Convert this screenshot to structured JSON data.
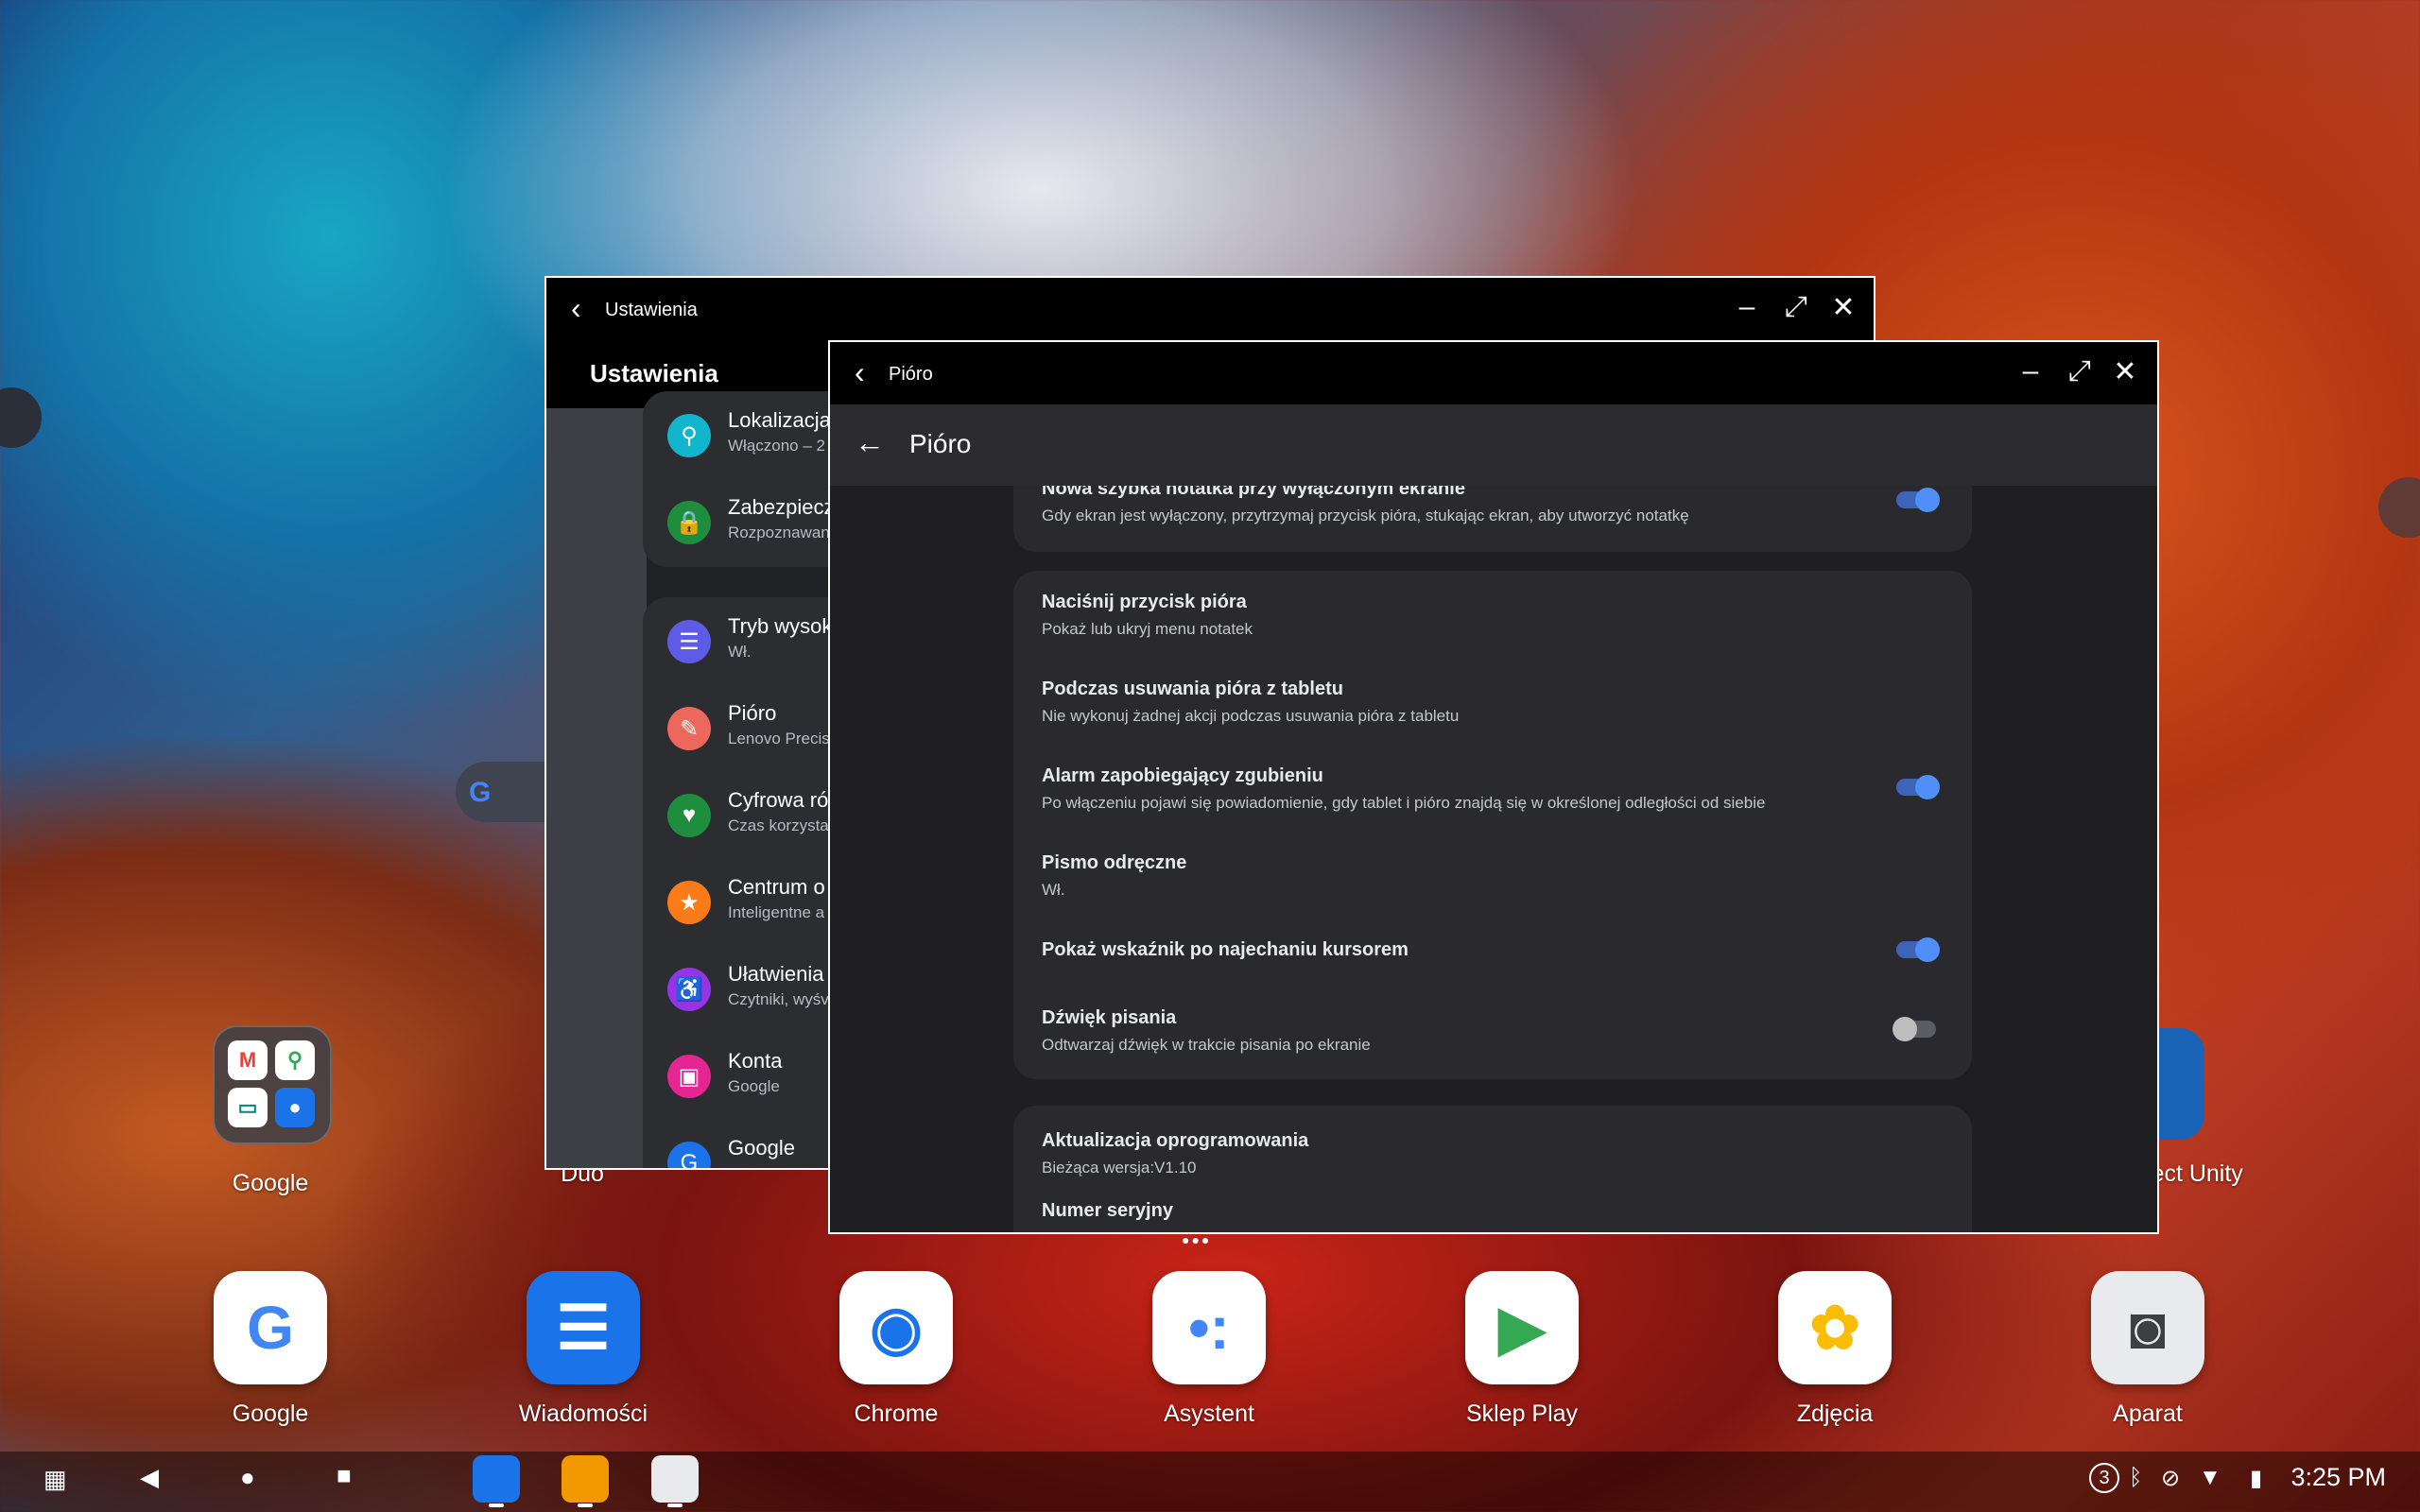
{
  "desktop": {
    "folder_label": "Google",
    "duo_label": "Duo",
    "unity_label": "ject Unity",
    "search_logo": "G"
  },
  "dock": [
    {
      "label": "Google",
      "icon": "google-icon",
      "glyph": "G",
      "color": "#4285f4"
    },
    {
      "label": "Wiadomości",
      "icon": "messages-icon",
      "glyph": "☰",
      "color": "#1a73e8"
    },
    {
      "label": "Chrome",
      "icon": "chrome-icon",
      "glyph": "◉",
      "color": "#1a73e8"
    },
    {
      "label": "Asystent",
      "icon": "assistant-icon",
      "glyph": "•:",
      "color": "#4285f4"
    },
    {
      "label": "Sklep Play",
      "icon": "play-store-icon",
      "glyph": "▶",
      "color": "#34a853"
    },
    {
      "label": "Zdjęcia",
      "icon": "photos-icon",
      "glyph": "✿",
      "color": "#fbbc04"
    },
    {
      "label": "Aparat",
      "icon": "camera-icon",
      "glyph": "◙",
      "color": "#5f6368"
    }
  ],
  "taskbar": {
    "time": "3:25 PM",
    "notification_count": "3"
  },
  "settings_window": {
    "title": "Ustawienia",
    "header": "Ustawienia",
    "items": [
      {
        "title": "Lokalizacja",
        "sub": "Włączono – 2",
        "color": "#12b5cb",
        "icon": "location-icon",
        "glyph": "⚲"
      },
      {
        "title": "Zabezpiecz",
        "sub": "Rozpoznawan",
        "color": "#1e8e3e",
        "icon": "lock-icon",
        "glyph": "🔒"
      },
      {
        "title": "Tryb wysok",
        "sub": "Wł.",
        "color": "#5e5ce6",
        "icon": "list-icon",
        "glyph": "☰"
      },
      {
        "title": "Pióro",
        "sub": "Lenovo Precis",
        "color": "#ee675c",
        "icon": "pen-icon",
        "glyph": "✎"
      },
      {
        "title": "Cyfrowa ró",
        "sub": "Czas korzysta",
        "color": "#1e8e3e",
        "icon": "wellbeing-icon",
        "glyph": "♥"
      },
      {
        "title": "Centrum o",
        "sub": "Inteligentne a",
        "color": "#fa7b17",
        "icon": "star-icon",
        "glyph": "★"
      },
      {
        "title": "Ułatwienia",
        "sub": "Czytniki, wyśv",
        "color": "#9334e6",
        "icon": "accessibility-icon",
        "glyph": "♿"
      },
      {
        "title": "Konta",
        "sub": "Google",
        "color": "#e52592",
        "icon": "accounts-icon",
        "glyph": "▣"
      },
      {
        "title": "Google",
        "sub": "",
        "color": "#1a73e8",
        "icon": "google-icon",
        "glyph": "G"
      }
    ]
  },
  "pen_window": {
    "title": "Pióro",
    "appbar_title": "Pióro",
    "group1": [
      {
        "title": "Nowa szybka notatka przy wyłączonym ekranie",
        "sub": "Gdy ekran jest wyłączony, przytrzymaj przycisk pióra, stukając ekran, aby utworzyć notatkę",
        "toggle": "on"
      }
    ],
    "group2": [
      {
        "title": "Naciśnij przycisk pióra",
        "sub": "Pokaż lub ukryj menu notatek",
        "toggle": ""
      },
      {
        "title": "Podczas usuwania pióra z tabletu",
        "sub": "Nie wykonuj żadnej akcji podczas usuwania pióra z tabletu",
        "toggle": ""
      },
      {
        "title": "Alarm zapobiegający zgubieniu",
        "sub": "Po włączeniu pojawi się powiadomienie, gdy tablet i pióro znajdą się w określonej odległości od siebie",
        "toggle": "on"
      },
      {
        "title": "Pismo odręczne",
        "sub": "Wł.",
        "toggle": ""
      },
      {
        "title": "Pokaż wskaźnik po najechaniu kursorem",
        "sub": "",
        "toggle": "on"
      },
      {
        "title": "Dźwięk pisania",
        "sub": "Odtwarzaj dźwięk w trakcie pisania po ekranie",
        "toggle": "off"
      }
    ],
    "group3": [
      {
        "title": "Aktualizacja oprogramowania",
        "sub": "Bieżąca wersja:V1.10"
      },
      {
        "title": "Numer seryjny",
        "sub": ""
      }
    ]
  }
}
